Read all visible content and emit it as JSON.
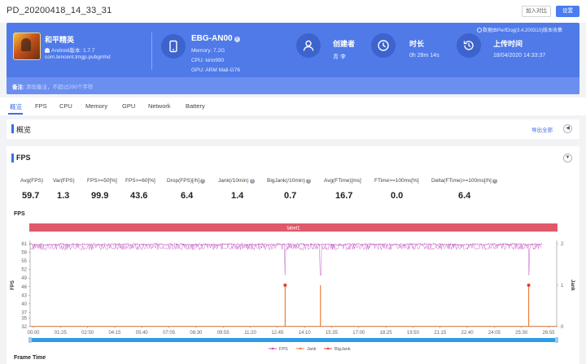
{
  "page": {
    "title": "PD_20200418_14_33_31",
    "compare_label": "加入对比",
    "settings_label": "设置"
  },
  "app": {
    "name": "和平精英",
    "android_version": "Android版本: 1.7.7",
    "package": "com.tencent.tmgp.pubgmhd"
  },
  "device": {
    "name": "EBG-AN00",
    "memory": "Memory: 7.2G",
    "cpu": "CPU: kirin990",
    "gpu": "GPU: ARM Mali-G76"
  },
  "creator": {
    "label": "创建者",
    "value": "青 李"
  },
  "duration": {
    "label": "时长",
    "value": "0h 28m 14s"
  },
  "upload": {
    "label": "上传时间",
    "value": "18/04/2020 14:33:37"
  },
  "perfdog_note": "数据由PerfDog(3.4.200310)版本收集",
  "remark": {
    "label": "备注:",
    "placeholder": "添加备注，不超过200个字符"
  },
  "tabs": [
    "概览",
    "FPS",
    "CPU",
    "Memory",
    "GPU",
    "Network",
    "Battery"
  ],
  "overview": {
    "title": "概览",
    "export_label": "导出全部"
  },
  "fps_section": {
    "title": "FPS",
    "metrics": [
      {
        "label": "Avg(FPS)",
        "value": "59.7",
        "help": false
      },
      {
        "label": "Var(FPS)",
        "value": "1.3",
        "help": false
      },
      {
        "label": "FPS>=50[%]",
        "value": "99.9",
        "help": false
      },
      {
        "label": "FPS>=60[%]",
        "value": "43.6",
        "help": false
      },
      {
        "label": "Drop(FPS)[/h]",
        "value": "6.4",
        "help": true
      },
      {
        "label": "Jank(/10min)",
        "value": "1.4",
        "help": true
      },
      {
        "label": "BigJank(/10min)",
        "value": "0.7",
        "help": true
      },
      {
        "label": "Avg(FTime)[ms]",
        "value": "16.7",
        "help": false
      },
      {
        "label": "FTime>=100ms[%]",
        "value": "0.0",
        "help": false
      },
      {
        "label": "Delta(FTime)>=100ms[/h]",
        "value": "6.4",
        "help": true
      }
    ],
    "chart_title": "FPS",
    "next_chart_title": "Frame Time"
  },
  "chart_data": {
    "type": "line",
    "title": "FPS",
    "label_band": "label1",
    "ylabel": "FPS",
    "y2label": "Jank",
    "ylim": [
      32,
      61
    ],
    "yticks": [
      61,
      58,
      55,
      52,
      49,
      46,
      43,
      40,
      37,
      35,
      32
    ],
    "y2lim": [
      0,
      2
    ],
    "y2ticks": [
      2,
      1,
      0
    ],
    "xticks": [
      "00:00",
      "01:25",
      "02:50",
      "04:15",
      "05:40",
      "07:05",
      "08:30",
      "09:55",
      "11:20",
      "12:45",
      "14:10",
      "15:35",
      "17:00",
      "18:25",
      "19:50",
      "21:15",
      "22:40",
      "24:05",
      "25:30",
      "26:55"
    ],
    "duration_seconds": 1694,
    "series": [
      {
        "name": "FPS",
        "color": "#c04fbf",
        "base_range": [
          58,
          61
        ],
        "dips": [
          {
            "t": 845,
            "v": 50
          },
          {
            "t": 962,
            "v": 50
          },
          {
            "t": 1652,
            "v": 50
          }
        ]
      },
      {
        "name": "Jank",
        "color": "#ef7d3a",
        "events": [
          {
            "t": 845,
            "v": 1
          },
          {
            "t": 962,
            "v": 1
          },
          {
            "t": 1652,
            "v": 1
          }
        ]
      },
      {
        "name": "BigJank",
        "color": "#e03a3a",
        "events": [
          {
            "t": 845,
            "v": 1
          },
          {
            "t": 1652,
            "v": 1
          }
        ]
      }
    ],
    "grid": false,
    "legend": "bottom-center"
  },
  "colors": {
    "accent": "#3c6ee6",
    "banner": "#4f7ae8",
    "label_band": "#e0596a",
    "fps": "#c04fbf",
    "jank": "#ef7d3a",
    "bigjank": "#e03a3a"
  }
}
